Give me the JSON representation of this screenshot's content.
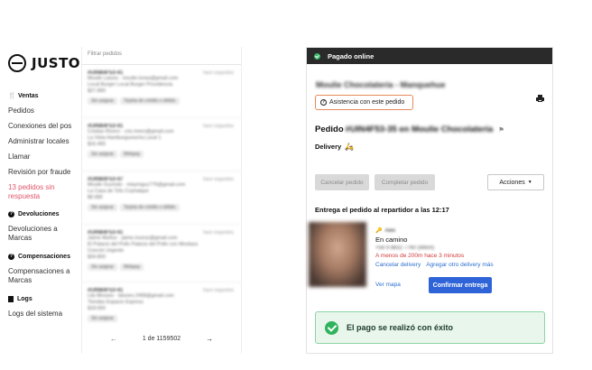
{
  "app": {
    "logo_text": "JUSTO"
  },
  "sidebar": {
    "sections": [
      {
        "label": "Ventas",
        "icon": "cutlery-icon",
        "items": [
          "Pedidos",
          "Conexiones del pos",
          "Administrar locales",
          "Llamar",
          "Revisión por fraude",
          "13 pedidos sin respuesta"
        ]
      },
      {
        "label": "Devoluciones",
        "icon": "question-icon",
        "items": [
          "Devoluciones a Marcas"
        ]
      },
      {
        "label": "Compensaciones",
        "icon": "question-icon",
        "items": [
          "Compensaciones a Marcas"
        ]
      },
      {
        "label": "Logs",
        "icon": "document-icon",
        "items": [
          "Logs del sistema"
        ]
      }
    ]
  },
  "orders": {
    "filter_placeholder": "Filtrar pedidos",
    "items": [
      {
        "id": "#UIN84F53-41",
        "time": "hace segundos",
        "lines": [
          "Moulie Laiuns · moulie.lunas@gmail.com",
          "Local Burger Local Burger Providencia",
          "$27.890"
        ],
        "tags": [
          "Sin asignar",
          "Tarjeta de crédito o débito"
        ]
      },
      {
        "id": "#UIN84F53-41",
        "time": "hace segundos",
        "lines": [
          "Cristian Rivero · cris.rivero@gmail.com",
          "La Vista Hamburguesería Local 1",
          "$16.490"
        ],
        "tags": [
          "Sin asignar",
          "Webpay"
        ]
      },
      {
        "id": "#UIN84F53-47",
        "time": "hace segundos",
        "lines": [
          "Moulie Guzmán · mlazmguz776@gmail.com",
          "La Casa de Tofu Coyhaique",
          "$9.980"
        ],
        "tags": [
          "Sin asignar",
          "Tarjeta de crédito o débito"
        ]
      },
      {
        "id": "#UIN84F53-41",
        "time": "hace segundos",
        "lines": [
          "Jaime Muñoz · jaime.munoz@gmail.com",
          "El Palacio del Pollo Palacio del Pollo con Mostaza",
          "Concón Urgente",
          "$34.800"
        ],
        "tags": [
          "Sin asignar",
          "Webpay"
        ]
      },
      {
        "id": "#UIN84F53-41",
        "time": "hace segundos",
        "lines": [
          "Lila Mosses · lalunes.2458@gmail.com",
          "Tiendas Espacio Express",
          "$18.650"
        ],
        "tags": [
          "Sin asignar"
        ]
      }
    ],
    "pager": {
      "text": "1 de 1159502",
      "prev": "←",
      "next": "→"
    }
  },
  "detail": {
    "header": "Pagado online",
    "store_name": "Moulie Chocolatería - Manquehue",
    "assist_label": "Asistencia con este pedido",
    "order_prefix": "Pedido",
    "order_id": "#UIN4F53-35 en Moulie Chocolatería",
    "delivery_label": "Delivery",
    "buttons": {
      "cancel": "Cancelar pedido",
      "complete": "Completar pedido",
      "actions": "Acciones"
    },
    "handoff_text": "Entrega el pedido al repartidor a las 12:17",
    "courier": {
      "name": "Alex",
      "status": "En camino",
      "phone": "+56 9 8832 7760 (Mitch)",
      "eta": "A menos de 200m hace 3 minutos",
      "cancel_link": "Cancelar delivery",
      "add_link": "Agregar otro delivery más",
      "map_link": "Ver mapa",
      "confirm_button": "Confirmar entrega"
    },
    "payment_success": "El pago se realizó con éxito"
  },
  "colors": {
    "alert": "#e0566a",
    "accent_blue": "#2f63d8",
    "success_green": "#2fb35c",
    "assist_border": "#e58a5a",
    "header_dark": "#2a2a2a"
  }
}
